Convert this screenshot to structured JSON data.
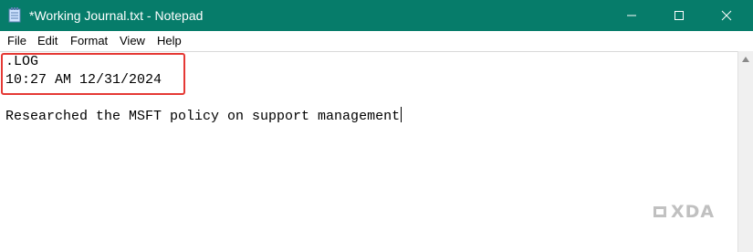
{
  "window": {
    "title": "*Working Journal.txt - Notepad",
    "titlebar_color": "#067c6a",
    "app_icon": "notepad-icon",
    "controls": [
      "minimize-icon",
      "maximize-icon",
      "close-icon"
    ]
  },
  "menu": {
    "items": [
      {
        "label": "File"
      },
      {
        "label": "Edit"
      },
      {
        "label": "Format"
      },
      {
        "label": "View"
      },
      {
        "label": "Help"
      }
    ]
  },
  "editor": {
    "lines": [
      ".LOG",
      "10:27 AM 12/31/2024",
      "",
      "Researched the MSFT policy on support management"
    ],
    "highlight_color": "#e53935"
  },
  "watermark": {
    "text": "XDA"
  }
}
